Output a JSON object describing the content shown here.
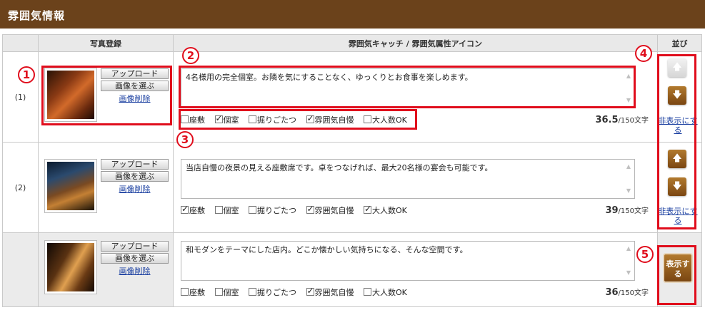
{
  "header": {
    "title": "雰囲気情報"
  },
  "columns": {
    "photo": "写真登録",
    "catch": "雰囲気キャッチ / 雰囲気属性アイコン",
    "order": "並び"
  },
  "buttons": {
    "upload": "アップロード",
    "choose": "画像を選ぶ",
    "delete": "画像削除",
    "hide": "非表示にする",
    "show": "表示する"
  },
  "char_suffix": "/150文字",
  "tags": [
    "座敷",
    "個室",
    "掘りごたつ",
    "雰囲気自慢",
    "大人数OK"
  ],
  "rows": [
    {
      "label": "(1)",
      "text": "4名様用の完全個室。お隣を気にすることなく、ゆっくりとお食事を楽しめます。",
      "checked": [
        false,
        true,
        false,
        true,
        false
      ],
      "count": "36.5",
      "image": "private-room-photo"
    },
    {
      "label": "(2)",
      "text": "当店自慢の夜景の見える座敷席です。卓をつなげれば、最大20名様の宴会も可能です。",
      "checked": [
        true,
        false,
        false,
        true,
        true
      ],
      "count": "39",
      "image": "night-view-seating-photo"
    },
    {
      "label": "",
      "text": "和モダンをテーマにした店内。どこか懐かしい気持ちになる、そんな空間です。",
      "checked": [
        false,
        false,
        false,
        true,
        false
      ],
      "count": "36",
      "image": "japanese-modern-interior-photo"
    }
  ],
  "annotations": [
    "1",
    "2",
    "3",
    "4",
    "5"
  ],
  "colors": {
    "header": "#6b421b",
    "accent_red": "#e00d1c",
    "button_brown": "#8a5418",
    "link": "#1a3fa0"
  },
  "icons": {
    "up": "arrow-up-icon",
    "down": "arrow-down-icon"
  }
}
